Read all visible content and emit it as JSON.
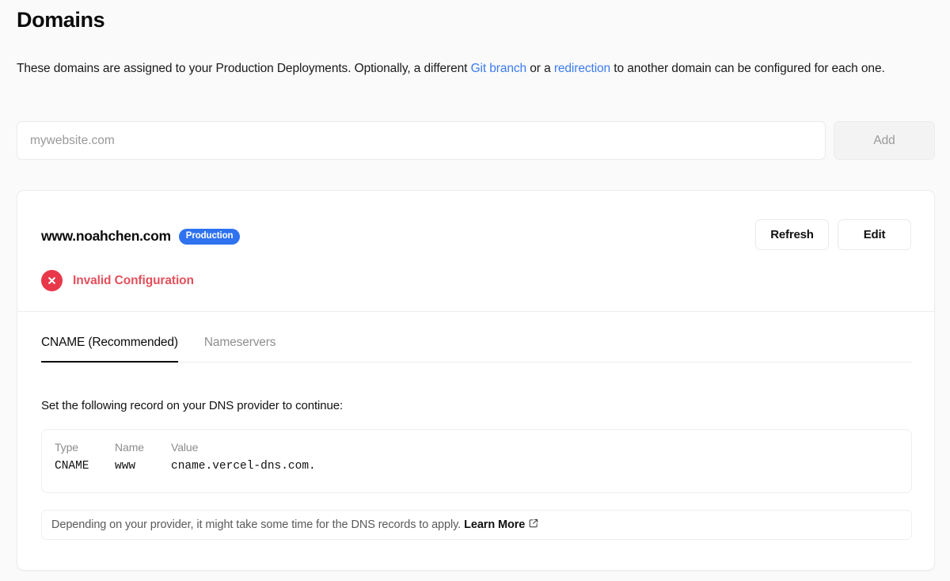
{
  "page": {
    "title": "Domains",
    "description": {
      "part1": "These domains are assigned to your Production Deployments. Optionally, a different ",
      "link1": "Git branch",
      "part2": " or a ",
      "link2": "redirection",
      "part3": " to another domain can be configured for each one."
    }
  },
  "add_domain": {
    "input_placeholder": "mywebsite.com",
    "input_value": "",
    "button_label": "Add"
  },
  "domain_card": {
    "domain_name": "www.noahchen.com",
    "badge_label": "Production",
    "badge_color": "#2f72ef",
    "status": {
      "icon": "error-circle-x-icon",
      "text": "Invalid Configuration",
      "color": "#e2505b"
    },
    "actions": {
      "refresh_label": "Refresh",
      "edit_label": "Edit"
    },
    "tabs": [
      {
        "label": "CNAME (Recommended)",
        "active": true
      },
      {
        "label": "Nameservers",
        "active": false
      }
    ],
    "instruction": "Set the following record on your DNS provider to continue:",
    "record_table": {
      "headers": [
        "Type",
        "Name",
        "Value"
      ],
      "rows": [
        {
          "type": "CNAME",
          "name": "www",
          "value": "cname.vercel-dns.com."
        }
      ]
    },
    "note": {
      "text": "Depending on your provider, it might take some time for the DNS records to apply.",
      "link_label": "Learn More",
      "link_icon": "external-link-icon"
    }
  }
}
